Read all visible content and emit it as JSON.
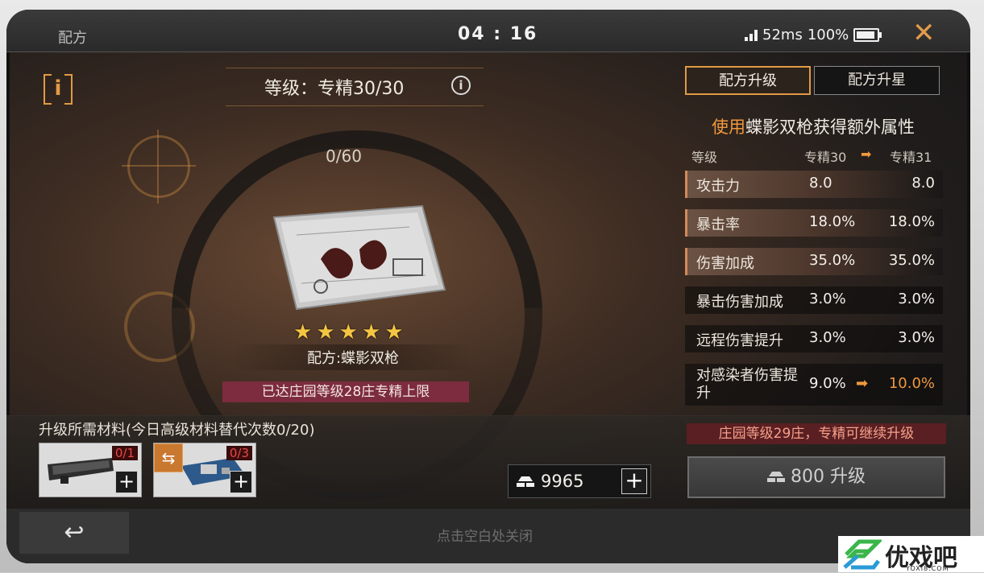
{
  "header": {
    "title": "配方",
    "clock": "04 : 16",
    "latency": "52ms",
    "battery": "100%"
  },
  "blueprint": {
    "level_label": "等级：专精30/30",
    "progress": "0/60",
    "stars": 5,
    "name": "配方:蝶影双枪",
    "limit_notice": "已达庄园等级28庄专精上限"
  },
  "tabs": [
    {
      "label": "配方升级",
      "active": true
    },
    {
      "label": "配方升星",
      "active": false
    }
  ],
  "bonus": {
    "prefix": "使用",
    "weapon": "蝶影双枪",
    "suffix": "获得额外属性"
  },
  "columns": {
    "level": "等级",
    "current": "专精30",
    "next": "专精31"
  },
  "stats": [
    {
      "name": "攻击力",
      "current": "8.0",
      "next": "8.0",
      "highlight": true,
      "upgrade": false
    },
    {
      "name": "暴击率",
      "current": "18.0%",
      "next": "18.0%",
      "highlight": true,
      "upgrade": false
    },
    {
      "name": "伤害加成",
      "current": "35.0%",
      "next": "35.0%",
      "highlight": true,
      "upgrade": false
    },
    {
      "name": "暴击伤害加成",
      "current": "3.0%",
      "next": "3.0%",
      "highlight": false,
      "upgrade": false
    },
    {
      "name": "远程伤害提升",
      "current": "3.0%",
      "next": "3.0%",
      "highlight": false,
      "upgrade": false
    },
    {
      "name": "对感染者伤害提升",
      "current": "9.0%",
      "next": "10.0%",
      "highlight": false,
      "upgrade": true
    }
  ],
  "materials": {
    "title": "升级所需材料(今日高级材料替代次数0/20)",
    "items": [
      {
        "count": "0/1",
        "icon": "gun-barrel-part-icon",
        "swap": false
      },
      {
        "count": "0/3",
        "icon": "circuit-board-icon",
        "swap": true
      }
    ]
  },
  "currency": {
    "amount": "9965",
    "icon": "gold-ingot-icon"
  },
  "upgrade": {
    "note": "庄园等级29庄，专精可继续升级",
    "cost": "800",
    "label": "升级"
  },
  "footer": {
    "close_hint": "点击空白处关闭"
  },
  "watermark": {
    "text": "优戏吧",
    "url": "YOXI8.COM"
  },
  "colors": {
    "accent": "#e29a45",
    "upgrade_orange": "#f0983c",
    "limit_banner": "#7c2c3e",
    "note_bg": "#5a1f22",
    "star": "#f4c542"
  }
}
